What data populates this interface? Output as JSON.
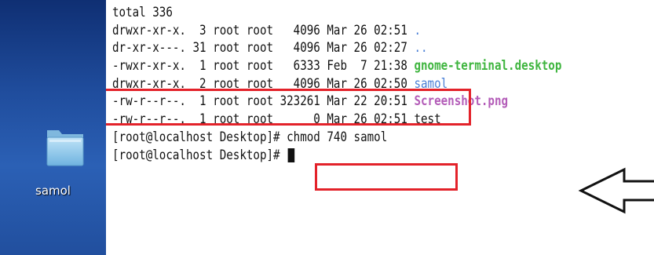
{
  "desktop": {
    "folder_label": "samol"
  },
  "terminal": {
    "lines": [
      {
        "text": "total 336"
      },
      {
        "text": "drwxr-xr-x.  3 root root   4096 Mar 26 02:51 ",
        "name": "."
      },
      {
        "text": "dr-xr-x---. 31 root root   4096 Mar 26 02:27 ",
        "name": ".."
      },
      {
        "text": "-rwxr-xr-x.  1 root root   6333 Feb  7 21:38 ",
        "name": "gnome-terminal.desktop"
      },
      {
        "text": "drwxr-xr-x.  2 root root   4096 Mar 26 02:50 ",
        "name": "samol"
      },
      {
        "text": "-rw-r--r--.  1 root root 323261 Mar 22 20:51 ",
        "name": "Screenshot.png"
      },
      {
        "text": "-rw-r--r--.  1 root root      0 Mar 26 02:51 ",
        "name": "test"
      },
      {
        "text": "[root@localhost Desktop]# ",
        "command": "chmod 740 samol"
      },
      {
        "text": "[root@localhost Desktop]# "
      }
    ]
  },
  "colors": {
    "directory": "#4a7fd6",
    "executable": "#3fb53f",
    "image": "#b35cb8",
    "highlight": "#e3222a"
  }
}
